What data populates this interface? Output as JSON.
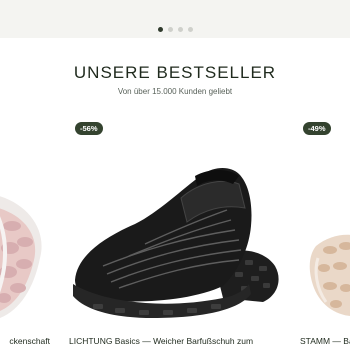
{
  "carousel": {
    "dot_count": 4,
    "active_index": 0
  },
  "section": {
    "title": "UNSERE BESTSELLER",
    "subtitle": "Von über 15.000 Kunden geliebt"
  },
  "products": [
    {
      "name_visible": "ckenschaft",
      "badge": ""
    },
    {
      "name_visible": "LICHTUNG Basics — Weicher Barfußschuh zum",
      "badge": "-56%"
    },
    {
      "name_visible": "STAMM — Ba",
      "badge": "-49%"
    }
  ],
  "colors": {
    "badge_bg": "#34432f",
    "heading": "#1f2a1d",
    "band": "#f4f4f1"
  }
}
